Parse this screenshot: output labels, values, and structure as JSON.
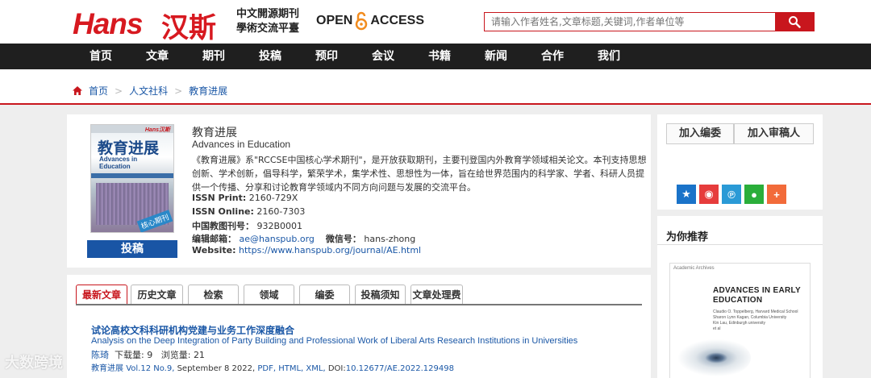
{
  "header": {
    "logo_latin": "Hans",
    "logo_cn": "汉斯",
    "slogan_line1": "中文開源期刊",
    "slogan_line2": "學術交流平臺",
    "open_access_left": "OPEN",
    "open_access_right": "ACCESS",
    "search_placeholder": "请输入作者姓名,文章标题,关键词,作者单位等"
  },
  "nav": [
    "首页",
    "文章",
    "期刊",
    "投稿",
    "预印",
    "会议",
    "书籍",
    "新闻",
    "合作",
    "我们"
  ],
  "breadcrumb": {
    "home": "首页",
    "sep": ">",
    "level2": "人文社科",
    "level3": "教育进展"
  },
  "journal": {
    "cover_brand": "Hans汉斯",
    "cover_title": "教育进展",
    "cover_sub1": "Advances in",
    "cover_sub2": "Education",
    "cover_stamp": "核心期刊",
    "submit_label": "投稿",
    "name_cn": "教育进展",
    "name_en": "Advances in Education",
    "description": "《教育进展》系\"RCCSE中国核心学术期刊\"，是开放获取期刊，主要刊登国内外教育学领域相关论文。本刊支持思想创新、学术创新，倡导科学，繁荣学术，集学术性、思想性为一体，旨在给世界范围内的科学家、学者、科研人员提供一个传播、分享和讨论教育学领域内不同方向问题与发展的交流平台。",
    "issn_print_label": "ISSN Print:",
    "issn_print": "2160-729X",
    "issn_online_label": "ISSN Online:",
    "issn_online": "2160-7303",
    "cn_code_label": "中国教图刊号：",
    "cn_code": "932B0001",
    "email_label": "编辑邮箱：",
    "email": "ae@hanspub.org",
    "wechat_label": "微信号：",
    "wechat": "hans-zhong",
    "website_label": "Website:",
    "website": "https://www.hanspub.org/journal/AE.html"
  },
  "sidebar": {
    "join_editorial": "加入编委",
    "join_reviewer": "加入审稿人",
    "share_icons": [
      "qzone-icon",
      "weibo-icon",
      "douban-icon",
      "wechat-icon",
      "more-icon"
    ],
    "share_colors": [
      "#1a73c9",
      "#e63c3c",
      "#2a9ad6",
      "#2aae3a",
      "#f26b3a"
    ],
    "recommend_title": "为你推荐",
    "rec_journal_small": "Academic Archives",
    "rec_journal_title1": "ADVANCES IN EARLY",
    "rec_journal_title2": "EDUCATION",
    "rec_authors": [
      "Claudio O. Toppelberg, Harvard Medical School",
      "Sharon Lynn Kagan, Columbia University",
      "Kin Lau, Edinburgh university",
      "et al"
    ]
  },
  "tabs": [
    "最新文章",
    "历史文章",
    "检索",
    "领域",
    "编委",
    "投稿须知",
    "文章处理费"
  ],
  "article": {
    "title_cn": "试论高校文科科研机构党建与业务工作深度融合",
    "title_en": "Analysis on the Deep Integration of Party Building and Professional Work of Liberal Arts Research Institutions in Universities",
    "author": "陈琦",
    "downloads_label": "下载量:",
    "downloads": "9",
    "views_label": "浏览量:",
    "views": "21",
    "journal": "教育进展",
    "volume": "Vol.12 No.9,",
    "date": "September 8 2022,",
    "formats": "PDF, HTML, XML,",
    "doi_label": "DOI:",
    "doi": "10.12677/AE.2022.129498"
  },
  "watermark": "大数跨境"
}
